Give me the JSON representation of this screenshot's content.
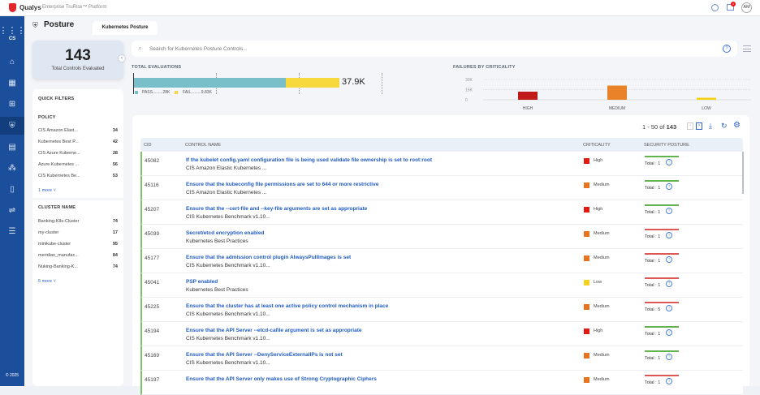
{
  "app": {
    "brand": "Qualys",
    "platform": "Enterprise TruRisk™ Platform",
    "avatar": "AM",
    "notif_count": "1",
    "sidebar_module": "CS",
    "copyright": "© 2025"
  },
  "page": {
    "title": "Posture",
    "tab": "Kubernetes Posture"
  },
  "summary": {
    "count": "143",
    "label": "Total Controls Evaluated"
  },
  "search": {
    "placeholder": "Search for Kubernetes Posture Controls..."
  },
  "total_evaluations": {
    "title": "TOTAL EVALUATIONS",
    "total": "37.9K",
    "pass_label": "PASS.........28K",
    "fail_label": "FAIL.........9.83K",
    "pass": 28,
    "fail": 9.83,
    "colors": {
      "pass": "#79bfc9",
      "fail": "#f7d83d"
    }
  },
  "chart_data": {
    "type": "bar",
    "title": "FAILURES BY CRITICALITY",
    "categories": [
      "HIGH",
      "MEDIUM",
      "LOW"
    ],
    "values": [
      12000,
      21000,
      3000
    ],
    "yticks": [
      "30K",
      "15K",
      "0"
    ],
    "ylim": [
      0,
      30000
    ],
    "colors": [
      "#c0191a",
      "#e8832a",
      "#f5d20f"
    ]
  },
  "quick_filters": {
    "title": "QUICK FILTERS",
    "policy": {
      "title": "POLICY",
      "items": [
        {
          "label": "CIS Amazon Elast...",
          "count": "34"
        },
        {
          "label": "Kubernetes Best P...",
          "count": "42"
        },
        {
          "label": "CIS Azure Kuberne...",
          "count": "28"
        },
        {
          "label": "Azure Kubernetes ...",
          "count": "56"
        },
        {
          "label": "CIS Kubernetes Be...",
          "count": "53"
        }
      ],
      "more": "1 more"
    },
    "cluster": {
      "title": "CLUSTER NAME",
      "items": [
        {
          "label": "Banking-K8s-Cluster",
          "count": "74"
        },
        {
          "label": "my-cluster",
          "count": "17"
        },
        {
          "label": "minikube-cluster",
          "count": "95"
        },
        {
          "label": "meridian_manufac...",
          "count": "84"
        },
        {
          "label": "Nuking-Banking-K...",
          "count": "74"
        }
      ],
      "more": "5 more"
    }
  },
  "table": {
    "pagination": "1 - 50 of",
    "total": "143",
    "headers": {
      "cid": "CID",
      "name": "CONTROL NAME",
      "crit": "CRITICALITY",
      "posture": "SECURITY POSTURE"
    },
    "rows": [
      {
        "cid": "45082",
        "name": "If the kubelet config.yaml configuration file is being used validate file ownership is set to root:root",
        "policy": "CIS Amazon Elastic Kubernetes ...",
        "crit": "High",
        "total": "Total : 1",
        "status": "pass"
      },
      {
        "cid": "45116",
        "name": "Ensure that the kubeconfig file permissions are set to 644 or more restrictive",
        "policy": "CIS Amazon Elastic Kubernetes ...",
        "crit": "Medium",
        "total": "Total : 1",
        "status": "pass"
      },
      {
        "cid": "45207",
        "name": "Ensure that the --cert-file and --key-file arguments are set as appropriate",
        "policy": "CIS Kubernetes Benchmark v1.10...",
        "crit": "High",
        "total": "Total : 1",
        "status": "pass"
      },
      {
        "cid": "45039",
        "name": "Secret/etcd encryption enabled",
        "policy": "Kubernetes Best Practices",
        "crit": "Medium",
        "total": "Total : 1",
        "status": "fail"
      },
      {
        "cid": "45177",
        "name": "Ensure that the admission control plugin AlwaysPullImages is set",
        "policy": "CIS Kubernetes Benchmark v1.10...",
        "crit": "Medium",
        "total": "Total : 1",
        "status": "fail"
      },
      {
        "cid": "45041",
        "name": "PSP enabled",
        "policy": "Kubernetes Best Practices",
        "crit": "Low",
        "total": "Total : 1",
        "status": "fail"
      },
      {
        "cid": "45225",
        "name": "Ensure that the cluster has at least one active policy control mechanism in place",
        "policy": "CIS Kubernetes Benchmark v1.10...",
        "crit": "Medium",
        "total": "Total : 5",
        "status": "fail"
      },
      {
        "cid": "45194",
        "name": "Ensure that the API Server --etcd-cafile argument is set as appropriate",
        "policy": "CIS Kubernetes Benchmark v1.10...",
        "crit": "High",
        "total": "Total : 1",
        "status": "pass"
      },
      {
        "cid": "45169",
        "name": "Ensure that the API Server --DenyServiceExternalIPs is not set",
        "policy": "CIS Kubernetes Benchmark v1.10...",
        "crit": "Medium",
        "total": "Total : 1",
        "status": "pass"
      },
      {
        "cid": "45197",
        "name": "Ensure that the API Server only makes use of Strong Cryptographic Ciphers",
        "policy": "",
        "crit": "Medium",
        "total": "Total : 1",
        "status": "fail"
      }
    ]
  },
  "colors": {
    "High": "#e11b10",
    "Medium": "#e8731e",
    "Low": "#f7d21c",
    "pass": "#62b34f",
    "fail": "#dd5555"
  }
}
